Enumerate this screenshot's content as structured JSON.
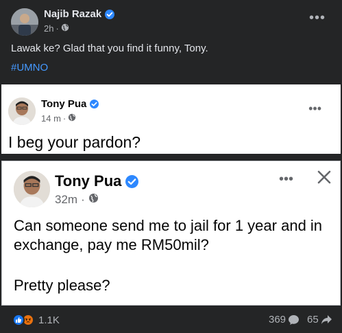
{
  "outer_post": {
    "author": "Najib Razak",
    "time": "2h",
    "text": "Lawak ke? Glad that you find it funny, Tony.",
    "hashtag": "#UMNO",
    "more_label": "•••"
  },
  "reply_screenshot": {
    "author": "Tony Pua",
    "time": "14 m",
    "text": "I beg your pardon?",
    "more_label": "•••"
  },
  "original_screenshot": {
    "author": "Tony Pua",
    "time": "32m",
    "text": "Can someone send me to jail for 1 year and in exchange, pay me RM50mil?",
    "text2": "Pretty please?",
    "more_label": "•••"
  },
  "footer": {
    "reaction_count": "1.1K",
    "comment_count": "369",
    "share_count": "65",
    "reaction_icons": [
      "like-icon",
      "angry-icon"
    ]
  },
  "colors": {
    "background": "#242526",
    "verified": "#2d88ff",
    "hashtag": "#4599ff",
    "like": "#1877f2",
    "angry": "#e9710f"
  }
}
